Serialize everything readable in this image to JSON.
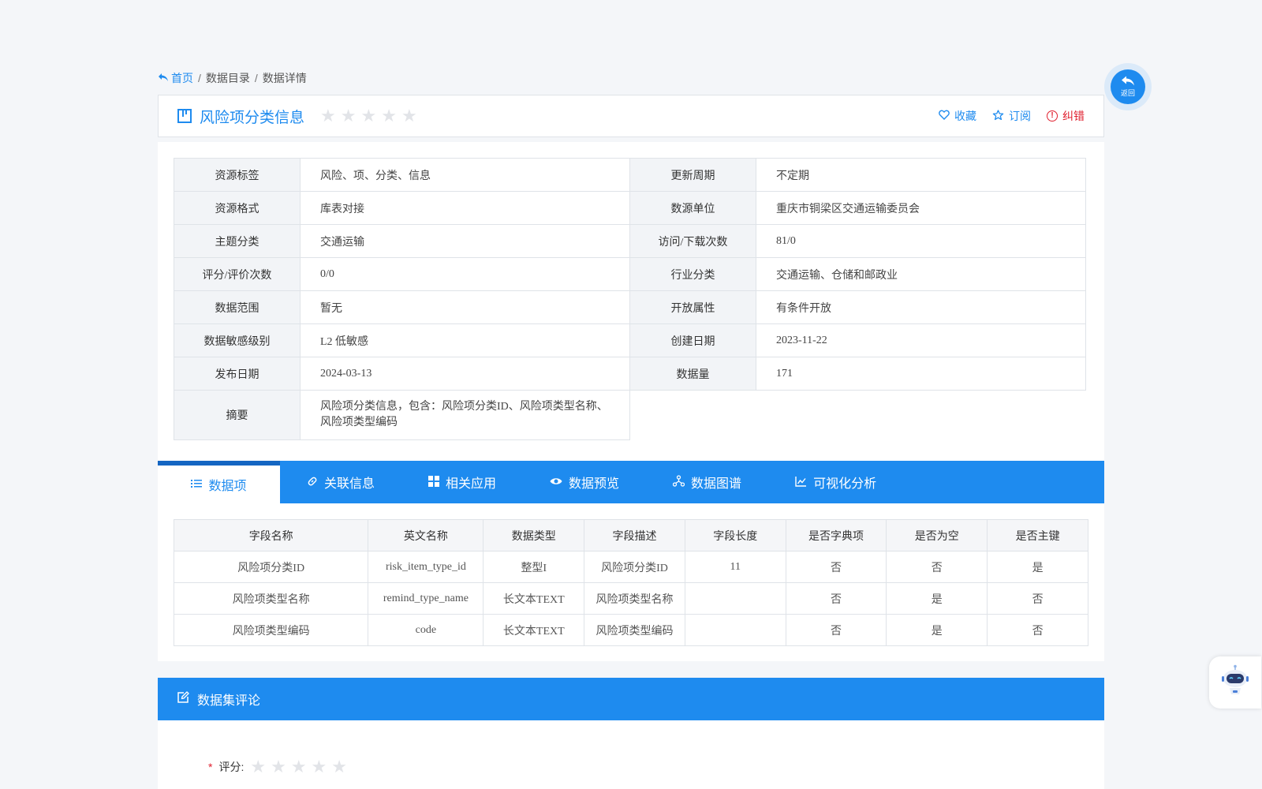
{
  "breadcrumb": {
    "home": "首页",
    "items": [
      "数据目录",
      "数据详情"
    ],
    "separator": "/"
  },
  "title": "风险项分类信息",
  "title_rating_stars": 0,
  "actions": {
    "favorite": "收藏",
    "subscribe": "订阅",
    "report_error": "纠错"
  },
  "info": {
    "rows": [
      {
        "k1": "资源标签",
        "v1": "风险、项、分类、信息",
        "k2": "更新周期",
        "v2": "不定期"
      },
      {
        "k1": "资源格式",
        "v1": "库表对接",
        "k2": "数源单位",
        "v2": "重庆市铜梁区交通运输委员会"
      },
      {
        "k1": "主题分类",
        "v1": "交通运输",
        "k2": "访问/下载次数",
        "v2": "81/0"
      },
      {
        "k1": "评分/评价次数",
        "v1": "0/0",
        "k2": "行业分类",
        "v2": "交通运输、仓储和邮政业"
      },
      {
        "k1": "数据范围",
        "v1": "暂无",
        "k2": "开放属性",
        "v2": "有条件开放"
      },
      {
        "k1": "数据敏感级别",
        "v1": "L2 低敏感",
        "k2": "创建日期",
        "v2": "2023-11-22"
      },
      {
        "k1": "发布日期",
        "v1": "2024-03-13",
        "k2": "数据量",
        "v2": "171"
      }
    ],
    "summary_key": "摘要",
    "summary_value": "风险项分类信息，包含：风险项分类ID、风险项类型名称、风险项类型编码"
  },
  "tabs": [
    "数据项",
    "关联信息",
    "相关应用",
    "数据预览",
    "数据图谱",
    "可视化分析"
  ],
  "fields_table": {
    "headers": [
      "字段名称",
      "英文名称",
      "数据类型",
      "字段描述",
      "字段长度",
      "是否字典项",
      "是否为空",
      "是否主键"
    ],
    "rows": [
      [
        "风险项分类ID",
        "risk_item_type_id",
        "整型I",
        "风险项分类ID",
        "11",
        "否",
        "否",
        "是"
      ],
      [
        "风险项类型名称",
        "remind_type_name",
        "长文本TEXT",
        "风险项类型名称",
        "",
        "否",
        "是",
        "否"
      ],
      [
        "风险项类型编码",
        "code",
        "长文本TEXT",
        "风险项类型编码",
        "",
        "否",
        "是",
        "否"
      ]
    ]
  },
  "review": {
    "title": "数据集评论",
    "required_mark": "*",
    "rating_label": "评分:"
  },
  "back_button": {
    "label": "返回"
  },
  "colors": {
    "primary": "#1e8bef",
    "danger": "#e0202f",
    "star_empty": "#e2e4e8"
  },
  "icons": {
    "home": "reply-icon",
    "favorite": "heart-icon",
    "subscribe": "star-outline-icon",
    "report": "alert-circle-icon",
    "assistant": "robot-icon"
  }
}
